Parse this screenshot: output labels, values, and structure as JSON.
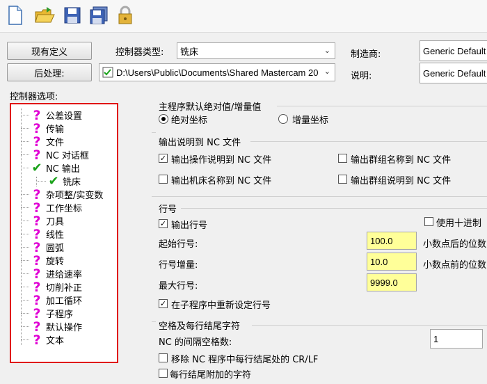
{
  "toolbar": {
    "icons": [
      "new-file-icon",
      "open-folder-icon",
      "save-icon",
      "save-as-icon",
      "lock-icon"
    ]
  },
  "controller": {
    "existing_def_button": "现有定义",
    "type_label": "控制器类型:",
    "type_value": "铣床",
    "manufacturer_label": "制造商:",
    "manufacturer_value": "Generic Default",
    "post_button": "后处理:",
    "post_path": "D:\\Users\\Public\\Documents\\Shared Mastercam 20",
    "description_label": "说明:",
    "description_value": "Generic Default"
  },
  "tree": {
    "title": "控制器选项:",
    "items": [
      {
        "label": "公差设置",
        "icon": "question-icon"
      },
      {
        "label": "传输",
        "icon": "question-icon"
      },
      {
        "label": "文件",
        "icon": "question-icon"
      },
      {
        "label": "NC 对话框",
        "icon": "question-icon"
      },
      {
        "label": "NC 输出",
        "icon": "checkmark-icon"
      },
      {
        "label": "铣床",
        "icon": "checkmark-icon"
      },
      {
        "label": "杂项整/实变数",
        "icon": "question-icon"
      },
      {
        "label": "工作坐标",
        "icon": "question-icon"
      },
      {
        "label": "刀具",
        "icon": "question-icon"
      },
      {
        "label": "线性",
        "icon": "question-icon"
      },
      {
        "label": "圆弧",
        "icon": "question-icon"
      },
      {
        "label": "旋转",
        "icon": "question-icon"
      },
      {
        "label": "进给速率",
        "icon": "question-icon"
      },
      {
        "label": "切削补正",
        "icon": "question-icon"
      },
      {
        "label": "加工循环",
        "icon": "question-icon"
      },
      {
        "label": "子程序",
        "icon": "question-icon"
      },
      {
        "label": "默认操作",
        "icon": "question-icon"
      },
      {
        "label": "文本",
        "icon": "question-icon"
      }
    ]
  },
  "main_program": {
    "title": "主程序默认绝对值/增量值",
    "absolute_label": "绝对坐标",
    "incremental_label": "增量坐标",
    "absolute_selected": true
  },
  "output_desc": {
    "title": "输出说明到 NC 文件",
    "op_desc": {
      "label": "输出操作说明到 NC 文件",
      "checked": true
    },
    "group_name": {
      "label": "输出群组名称到 NC 文件",
      "checked": false
    },
    "machine_name": {
      "label": "输出机床名称到 NC 文件",
      "checked": false
    },
    "group_desc": {
      "label": "输出群组说明到 NC 文件",
      "checked": false
    }
  },
  "line_numbers": {
    "title": "行号",
    "output_label": "输出行号",
    "output_checked": true,
    "use_decimal_label": "使用十进制",
    "use_decimal_checked": false,
    "start_label": "起始行号:",
    "start_value": "100.0",
    "increment_label": "行号增量:",
    "increment_value": "10.0",
    "max_label": "最大行号:",
    "max_value": "9999.0",
    "after_decimal_label": "小数点后的位数",
    "before_decimal_label": "小数点前的位数",
    "reset_label": "在子程序中重新设定行号",
    "reset_checked": true
  },
  "spaces": {
    "title": "空格及每行结尾字符",
    "nc_spaces_label": "NC 的间隔空格数:",
    "nc_spaces_value": "1",
    "remove_crlf_label": "移除 NC 程序中每行结尾处的 CR/LF",
    "remove_crlf_checked": false,
    "append_chars_label": "每行结尾附加的字符",
    "append_chars_checked": false
  }
}
